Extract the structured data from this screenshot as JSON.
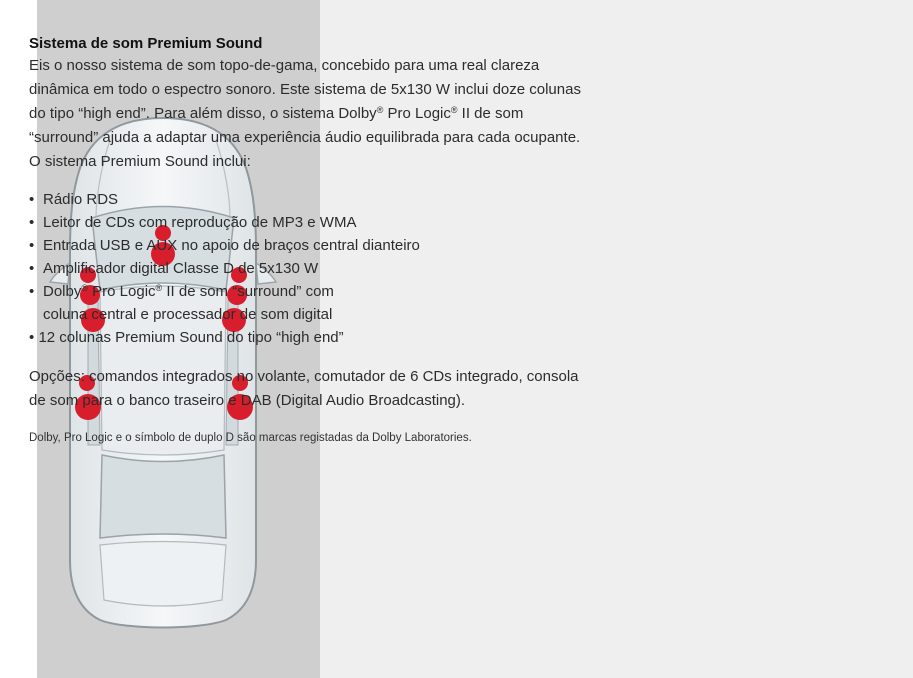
{
  "section": {
    "heading": "Sistema de som Premium Sound",
    "intro": {
      "p1": "Eis o nosso sistema de som topo-de-gama, concebido para uma real clareza dinâmica em todo o espectro sonoro. Este sistema de 5x130 W inclui doze colunas do tipo “high end”. Para além disso, o sistema Dolby",
      "p2": " Pro Logic",
      "p3": " II de som “surround” ajuda a adaptar uma experiência áudio equilibrada para cada ocupante. O sistema Premium Sound inclui:"
    },
    "features": {
      "bullet": "•",
      "registered": "®",
      "item1": "Rádio RDS",
      "item2": "Leitor de CDs com reprodução de MP3 e WMA",
      "item3": "Entrada USB e AUX no apoio de braços central dianteiro",
      "item4": "Amplificador digital Classe D de 5x130 W",
      "item5a": "Dolby",
      "item5b": " Pro Logic",
      "item5c": " II de som “surround” com",
      "item5d": "coluna central e processador de som digital",
      "item6": "12 colunas Premium Sound do tipo “high end”"
    },
    "options": "Opções: comandos integrados no volante, comutador de 6 CDs integrado, consola de som para o banco traseiro e DAB (Digital Audio Broadcasting).",
    "footnote": "Dolby, Pro Logic e o símbolo de duplo D são marcas registadas da Dolby Laboratories."
  },
  "colors": {
    "left_panel": "#cfcfcf",
    "right_panel": "#efefef",
    "speaker": "#d81e2c",
    "car_body": "#eef1f3",
    "car_glass": "#d6dee2"
  }
}
